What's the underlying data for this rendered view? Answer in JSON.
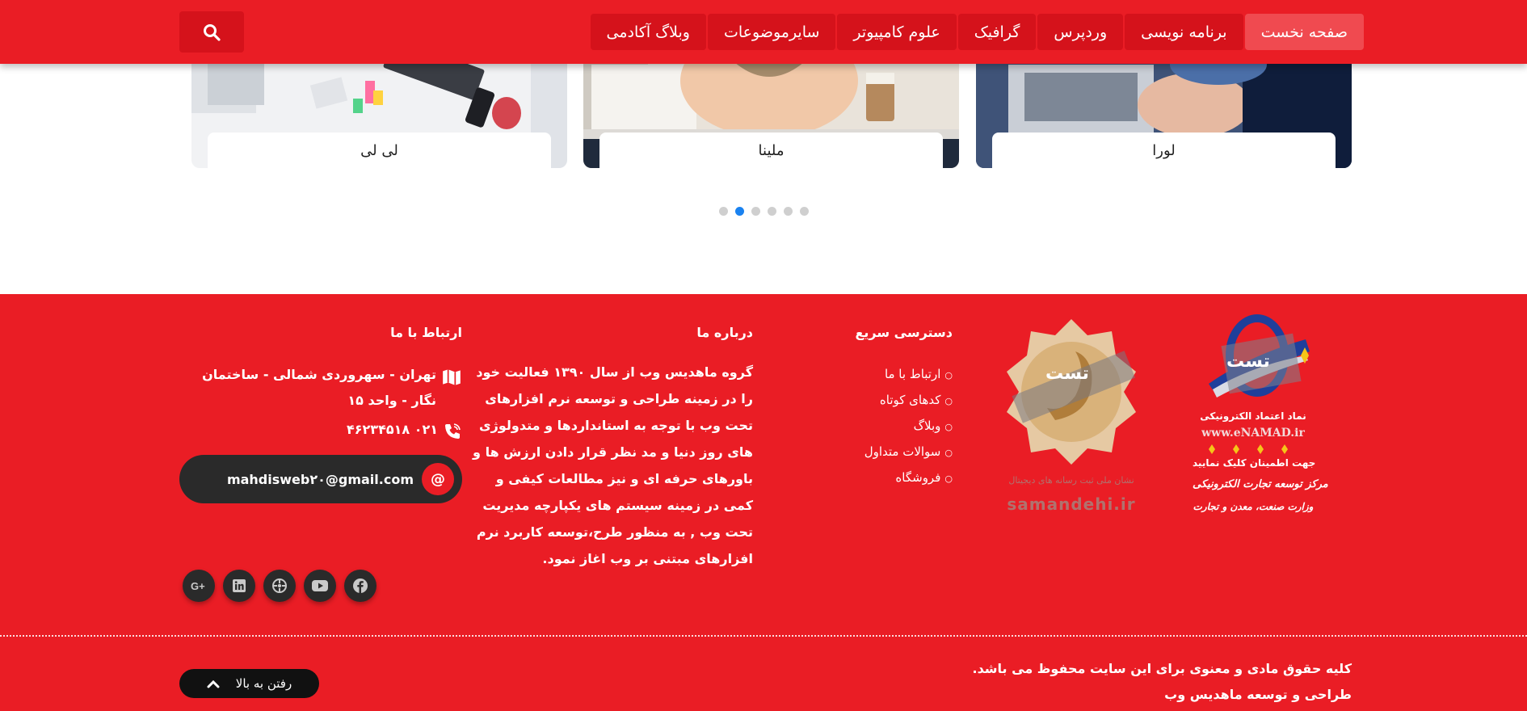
{
  "header": {
    "nav": [
      {
        "label": "صفحه نخست",
        "active": true
      },
      {
        "label": "برنامه نویسی",
        "active": false
      },
      {
        "label": "وردپرس",
        "active": false
      },
      {
        "label": "گرافیک",
        "active": false
      },
      {
        "label": "علوم کامپیوتر",
        "active": false
      },
      {
        "label": "سایرموضوعات",
        "active": false
      },
      {
        "label": "وبلاگ آکادمی",
        "active": false
      }
    ],
    "search_icon": "search-icon"
  },
  "carousel": {
    "cards": [
      {
        "caption": "لورا"
      },
      {
        "caption": "ملینا"
      },
      {
        "caption": "لی لی"
      }
    ],
    "dots_total": 6,
    "active_dot": 1
  },
  "footer": {
    "badges": {
      "enamad": {
        "logo_text": "تست",
        "line1": "نماد اعتماد الکترونیکی",
        "line2": "www.eNAMAD.ir",
        "line3": "جهت اطمینان کلیک نمایید",
        "line4": "مرکز توسعه تجارت الکترونیکی",
        "line5": "وزارت صنعت، معدن و تجارت"
      },
      "samandehi": {
        "logo_text": "تست",
        "line1": "نشان ملی ثبت رسانه های دیجیتال",
        "line2": "samandehi.ir"
      }
    },
    "quick_access": {
      "heading": "دسترسی سریع",
      "links": [
        "ارتباط با ما",
        "کدهای کوتاه",
        "وبلاگ",
        "سوالات متداول",
        "فروشگاه"
      ]
    },
    "about": {
      "heading": "درباره ما",
      "text": "گروه ماهدیس وب از سال ۱۳۹۰ فعالیت خود را در زمینه طراحی و توسعه نرم افزارهای تحت وب با توجه به استانداردها و متدولوژی های روز دنیا و مد نظر قرار دادن ارزش ها و باورهای حرفه ای و نیز مطالعات کیفی و کمی در زمینه سیستم های یکپارچه مدیریت تحت وب , به منظور طرح،توسعه کاربرد نرم افزارهای مبتنی بر وب اغاز نمود."
    },
    "contact": {
      "heading": "ارتباط با ما",
      "address": "تهران - سهروردی شمالی - ساختمان نگار - واحد ۱۵",
      "phone": "۰۲۱ ۴۶۲۳۴۵۱۸",
      "email": "mahdisweb۲۰@gmail.com",
      "email_icon": "@"
    },
    "socials": [
      "google-plus-icon",
      "linkedin-icon",
      "dribbble-icon",
      "youtube-icon",
      "facebook-icon"
    ],
    "copyright": {
      "line1": "کلیه حقوق مادی و معنوی برای این سایت محفوظ می باشد.",
      "line2": "طراحی و توسعه ماهدیس وب"
    },
    "back_to_top": "رفتن به بالا"
  }
}
